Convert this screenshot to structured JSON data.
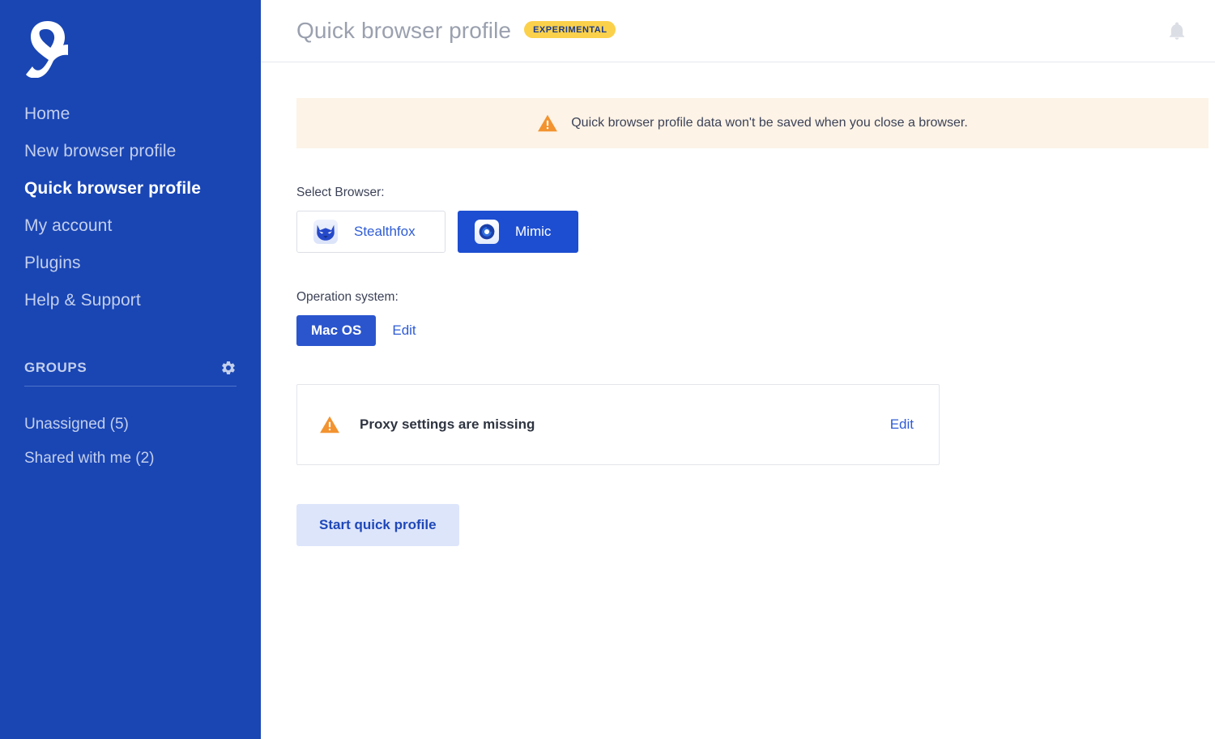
{
  "sidebar": {
    "logo_name": "multilogin-logo",
    "nav": [
      {
        "label": "Home",
        "name": "sidebar-item-home",
        "active": false
      },
      {
        "label": "New browser profile",
        "name": "sidebar-item-new-browser-profile",
        "active": false
      },
      {
        "label": "Quick browser profile",
        "name": "sidebar-item-quick-browser-profile",
        "active": true
      },
      {
        "label": "My account",
        "name": "sidebar-item-my-account",
        "active": false
      },
      {
        "label": "Plugins",
        "name": "sidebar-item-plugins",
        "active": false
      },
      {
        "label": "Help & Support",
        "name": "sidebar-item-help-support",
        "active": false
      }
    ],
    "groups": {
      "title": "GROUPS",
      "settings_icon": "gear-icon",
      "items": [
        {
          "label": "Unassigned (5)",
          "name": "group-item-unassigned"
        },
        {
          "label": "Shared with me (2)",
          "name": "group-item-shared-with-me"
        }
      ]
    },
    "colors": {
      "background": "#1a46b4",
      "text": "#c3cfec",
      "active_text": "#ffffff"
    }
  },
  "header": {
    "title": "Quick browser profile",
    "badge": "EXPERIMENTAL",
    "badge_color": "#fbd14b",
    "notifications_icon": "bell-icon"
  },
  "main": {
    "warning_banner": {
      "icon": "warning-triangle-icon",
      "text": "Quick browser profile data won't be saved when you close a browser.",
      "background": "#fdf3e7",
      "icon_color": "#f29330"
    },
    "browser_section": {
      "label": "Select Browser:",
      "options": [
        {
          "label": "Stealthfox",
          "icon": "stealthfox-fox-icon",
          "selected": false
        },
        {
          "label": "Mimic",
          "icon": "mimic-chrome-icon",
          "selected": true
        }
      ]
    },
    "os_section": {
      "label": "Operation system:",
      "value": "Mac OS",
      "edit_label": "Edit"
    },
    "proxy_card": {
      "icon": "warning-triangle-icon",
      "text": "Proxy settings are missing",
      "edit_label": "Edit"
    },
    "start_button": {
      "label": "Start quick profile",
      "background": "#dde5fb",
      "text_color": "#1f48b8"
    }
  }
}
